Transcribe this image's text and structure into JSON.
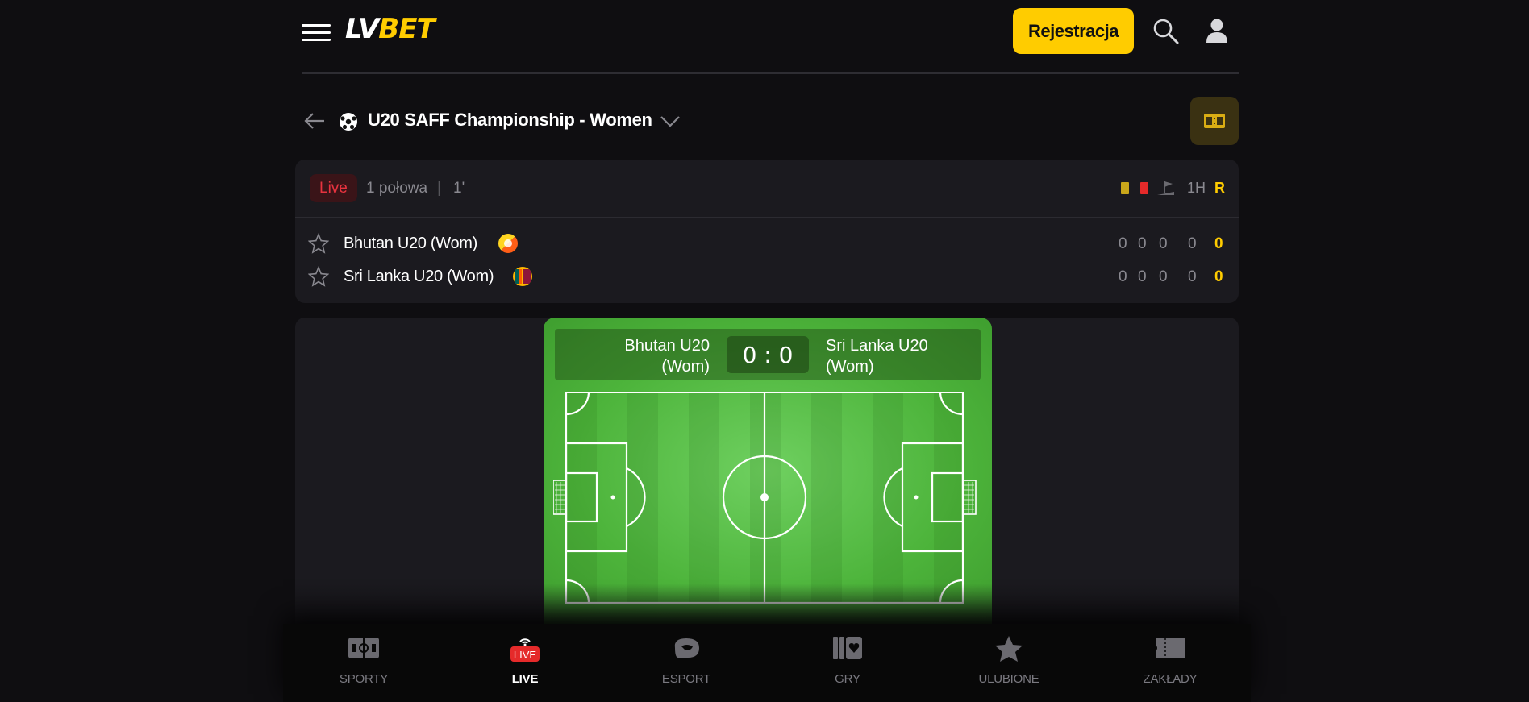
{
  "header": {
    "logo_lv": "LV",
    "logo_bet": "BET",
    "register_label": "Rejestracja"
  },
  "tournament": {
    "title": "U20 SAFF Championship - Women"
  },
  "match": {
    "live_label": "Live",
    "period": "1 połowa",
    "separator": "|",
    "minute": "1'",
    "col_1h": "1H",
    "col_r": "R",
    "teams": [
      {
        "name": "Bhutan U20 (Wom)",
        "scores": [
          "0",
          "0",
          "0",
          "0"
        ],
        "total": "0"
      },
      {
        "name": "Sri Lanka U20 (Wom)",
        "scores": [
          "0",
          "0",
          "0",
          "0"
        ],
        "total": "0"
      }
    ]
  },
  "field": {
    "home_line1": "Bhutan U20",
    "home_line2": "(Wom)",
    "away_line1": "Sri Lanka U20",
    "away_line2": "(Wom)",
    "score": "0 : 0"
  },
  "nav": [
    {
      "label": "SPORTY",
      "icon": "sports-icon",
      "active": false
    },
    {
      "label": "LIVE",
      "icon": "live-icon",
      "active": true
    },
    {
      "label": "ESPORT",
      "icon": "esport-icon",
      "active": false
    },
    {
      "label": "GRY",
      "icon": "cards-icon",
      "active": false
    },
    {
      "label": "ULUBIONE",
      "icon": "star-icon",
      "active": false
    },
    {
      "label": "ZAKŁADY",
      "icon": "ticket-icon",
      "active": false
    }
  ],
  "colors": {
    "accent": "#ffcc00",
    "live_red": "#e8333f",
    "background": "#0f0e11",
    "card": "#1b1a1f",
    "pitch_green": "#4db43b"
  }
}
